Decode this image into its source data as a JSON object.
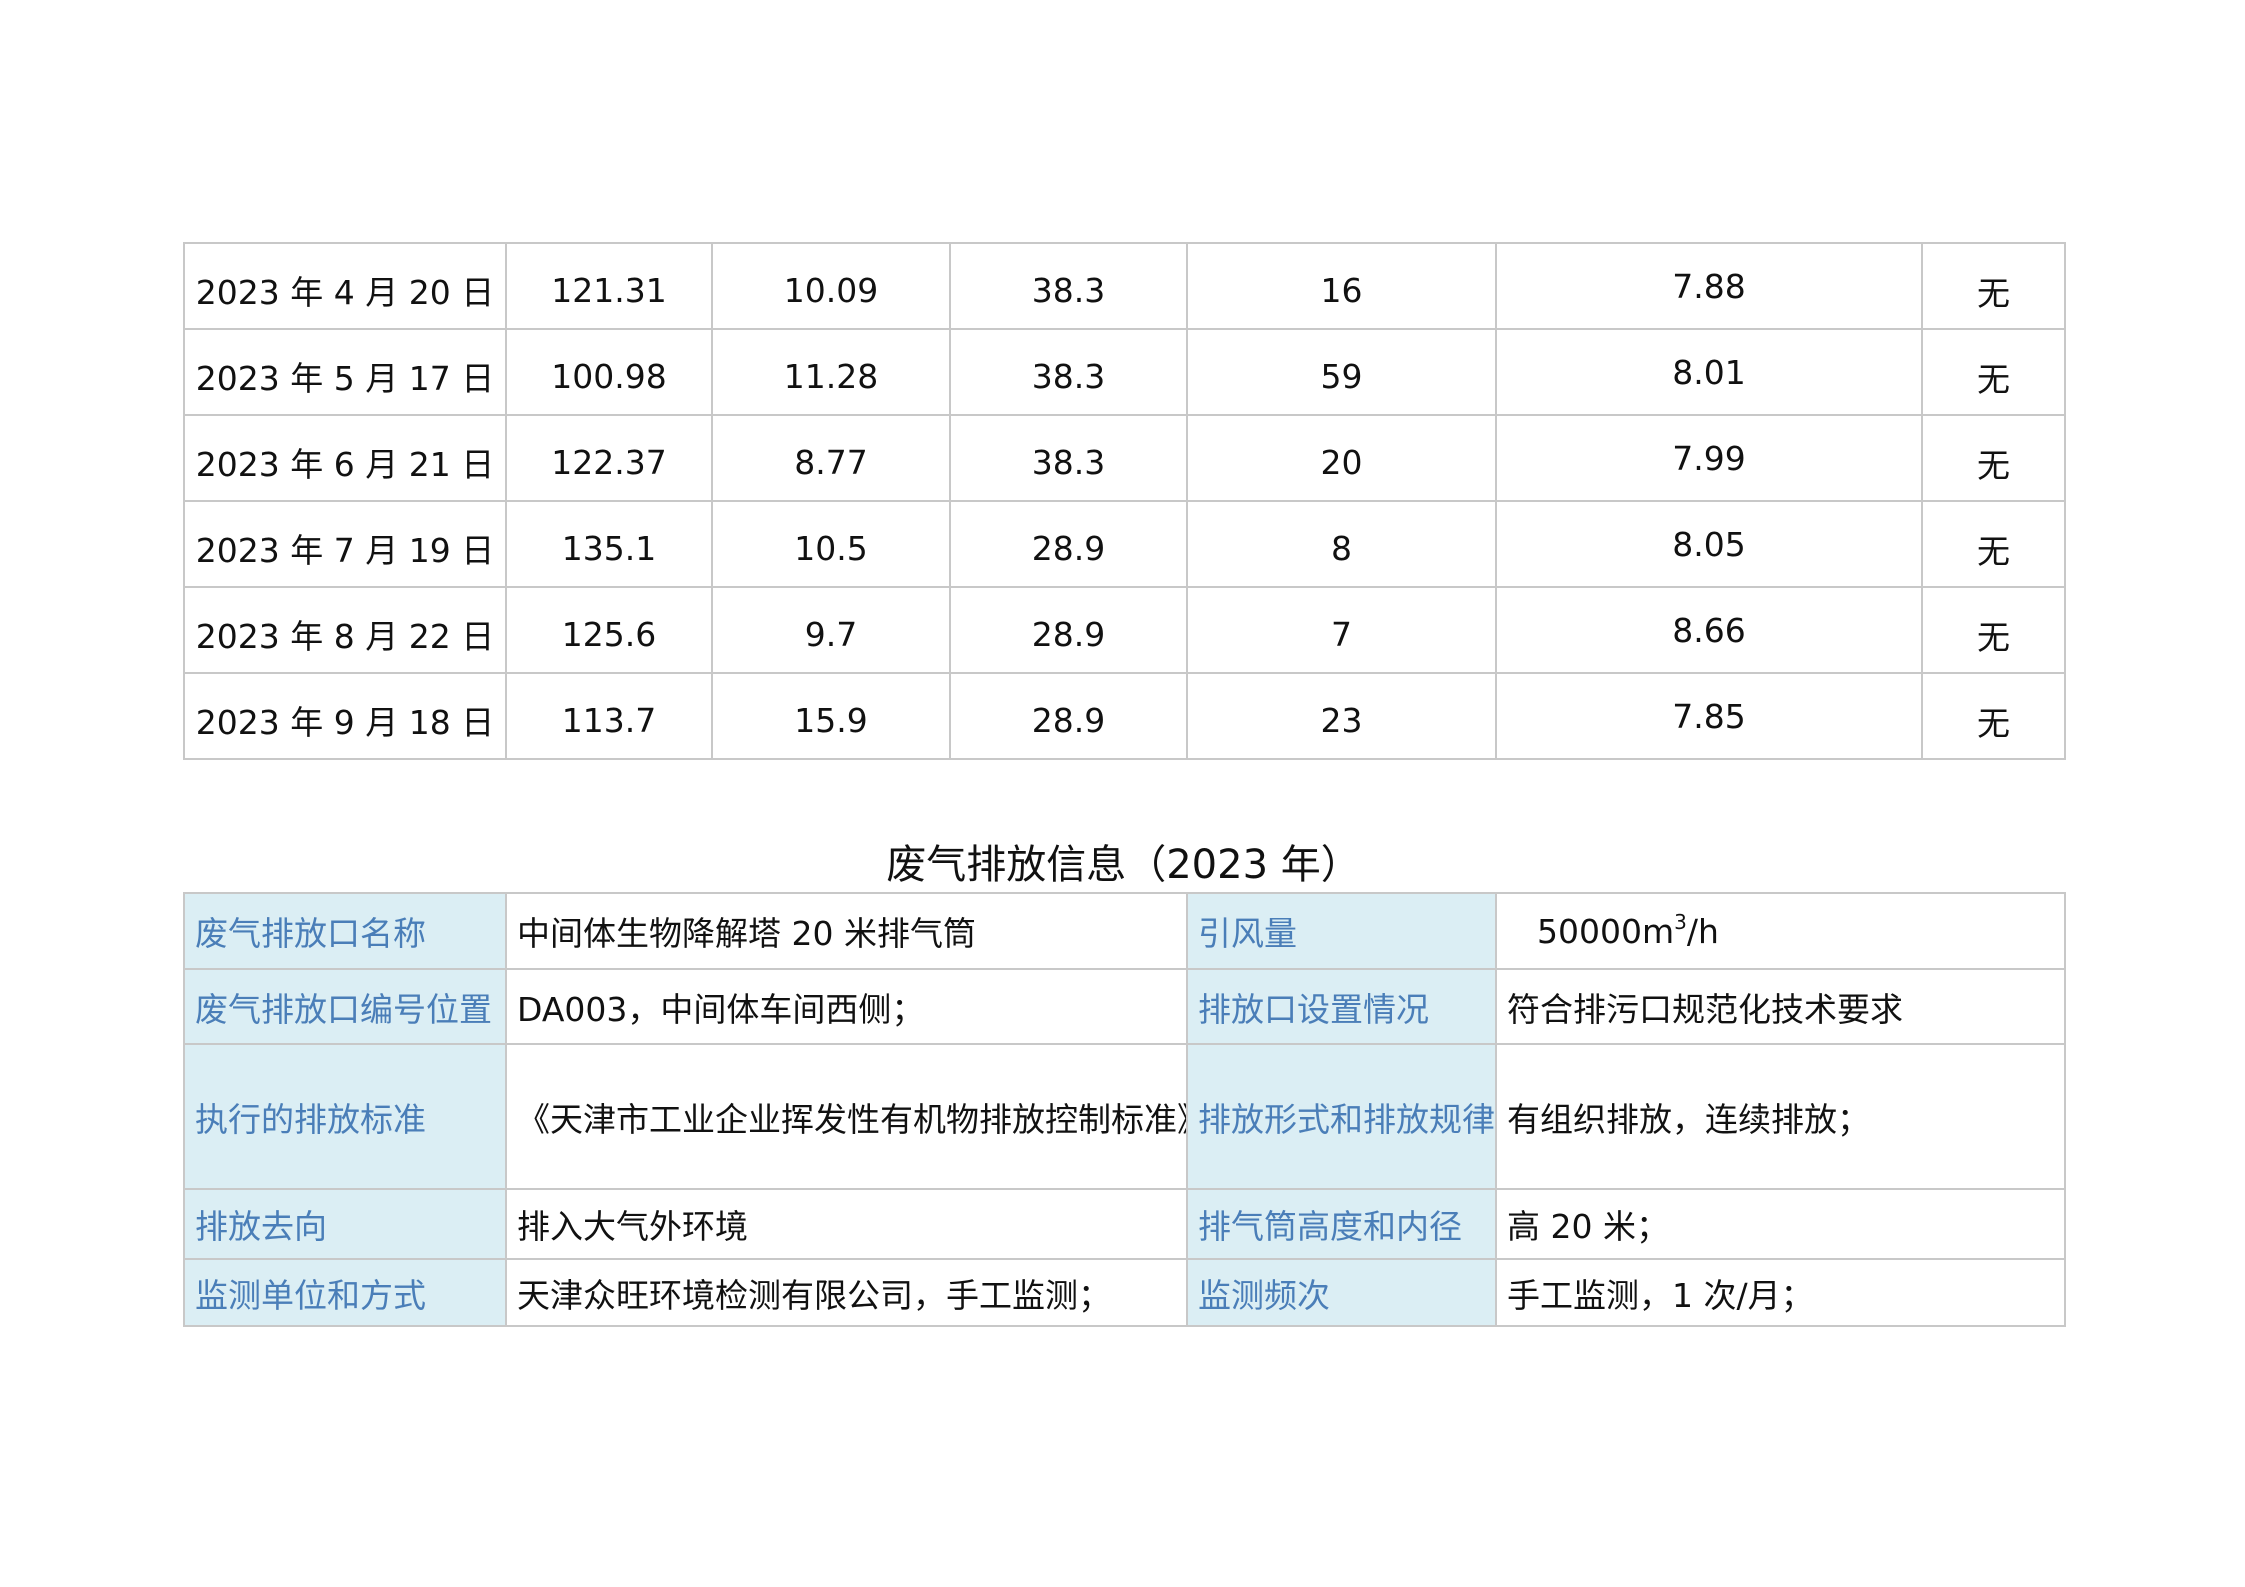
{
  "monthly_rows": [
    {
      "date": "2023 年 4 月 20 日",
      "v1": "121.31",
      "v2": "10.09",
      "v3": "38.3",
      "v4": "16",
      "v5": "7.88",
      "remark": "无"
    },
    {
      "date": "2023 年 5 月 17 日",
      "v1": "100.98",
      "v2": "11.28",
      "v3": "38.3",
      "v4": "59",
      "v5": "8.01",
      "remark": "无"
    },
    {
      "date": "2023 年 6 月 21 日",
      "v1": "122.37",
      "v2": "8.77",
      "v3": "38.3",
      "v4": "20",
      "v5": "7.99",
      "remark": "无"
    },
    {
      "date": "2023 年 7 月 19 日",
      "v1": "135.1",
      "v2": "10.5",
      "v3": "28.9",
      "v4": "8",
      "v5": "8.05",
      "remark": "无"
    },
    {
      "date": "2023 年 8 月 22 日",
      "v1": "125.6",
      "v2": "9.7",
      "v3": "28.9",
      "v4": "7",
      "v5": "8.66",
      "remark": "无"
    },
    {
      "date": "2023 年 9 月 18 日",
      "v1": "113.7",
      "v2": "15.9",
      "v3": "28.9",
      "v4": "23",
      "v5": "7.85",
      "remark": "无"
    }
  ],
  "section_title": "废气排放信息（2023 年）",
  "info": {
    "outlet_name_label": "废气排放口名称",
    "outlet_name_value": "中间体生物降解塔 20 米排气筒",
    "airflow_label": "引风量",
    "airflow_value_main": "50000m",
    "airflow_value_sup": "3",
    "airflow_value_tail": "/h",
    "outlet_id_label": "废气排放口编号位置",
    "outlet_id_value": "DA003，中间体车间西侧；",
    "outlet_setting_label": "排放口设置情况",
    "outlet_setting_value": "符合排污口规范化技术要求",
    "standard_label": "执行的排放标准",
    "standard_value": "《天津市工业企业挥发性有机物排放控制标准》",
    "pattern_label": "排放形式和排放规律",
    "pattern_value": "有组织排放，连续排放；",
    "destination_label": "排放去向",
    "destination_value": "排入大气外环境",
    "stack_label": "排气筒高度和内径",
    "stack_value": "高 20 米；",
    "monitor_unit_label": "监测单位和方式",
    "monitor_unit_value": "天津众旺环境检测有限公司，手工监测；",
    "frequency_label": "监测频次",
    "frequency_value": "手工监测，1 次/月；"
  }
}
